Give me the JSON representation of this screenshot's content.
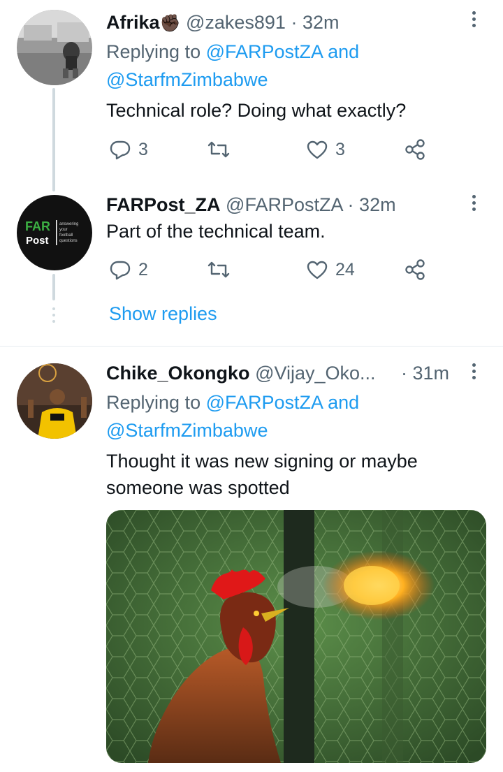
{
  "tweets": [
    {
      "name": "Afrika",
      "emoji": "✊🏿",
      "handle": "@zakes891",
      "time": "32m",
      "replying_prefix": "Replying to",
      "replying_to_1": "@FARPostZA",
      "replying_and": "and",
      "replying_to_2": "@StarfmZimbabwe",
      "text": "Technical role? Doing what exactly?",
      "reply_count": "3",
      "like_count": "3"
    },
    {
      "name": "FARPost_ZA",
      "handle": "@FARPostZA",
      "time": "32m",
      "text": "Part of the technical team.",
      "reply_count": "2",
      "like_count": "24",
      "avatar_logo": {
        "far": "FAR",
        "post": "Post",
        "tagline": [
          "answering",
          "your",
          "football",
          "questions"
        ]
      }
    },
    {
      "name": "Chike_Okongko",
      "handle": "@Vijay_Oko...",
      "time": "31m",
      "replying_prefix": "Replying to",
      "replying_to_1": "@FARPostZA",
      "replying_and": "and",
      "replying_to_2": "@StarfmZimbabwe",
      "text_line1": "Thought it was new signing or maybe",
      "text_line2": "someone was spotted"
    }
  ],
  "show_replies": "Show replies",
  "colors": {
    "link": "#1d9bf0",
    "muted": "#536471",
    "text": "#0f1419",
    "thread_line": "#cfd9de"
  },
  "icons": [
    "reply-icon",
    "retweet-icon",
    "like-icon",
    "share-icon",
    "more-icon"
  ]
}
